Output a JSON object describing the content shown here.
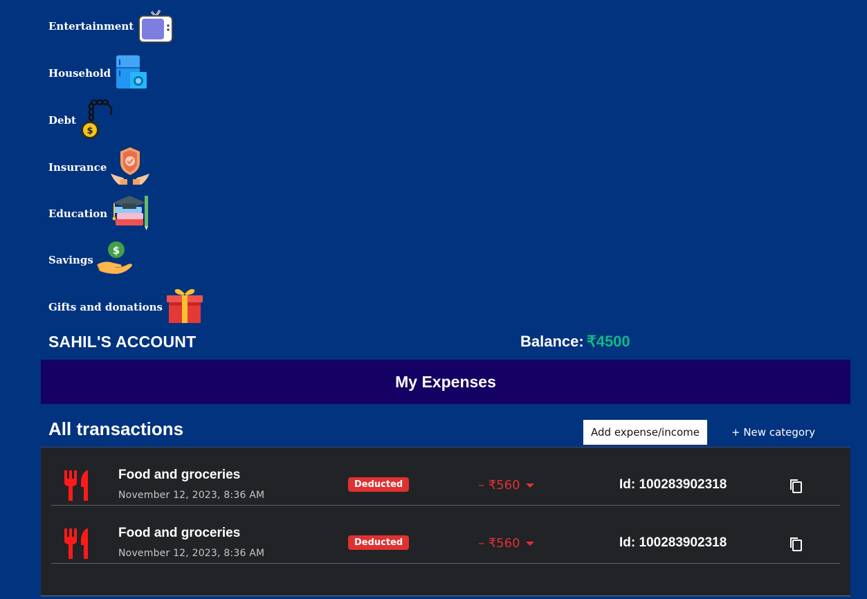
{
  "categories": [
    {
      "label": "Entertainment",
      "icon": "tv-icon"
    },
    {
      "label": "Household",
      "icon": "appliances-icon"
    },
    {
      "label": "Debt",
      "icon": "ball-and-chain-icon"
    },
    {
      "label": "Insurance",
      "icon": "shield-hands-icon"
    },
    {
      "label": "Education",
      "icon": "graduation-books-icon"
    },
    {
      "label": "Savings",
      "icon": "money-hand-icon"
    },
    {
      "label": "Gifts and donations",
      "icon": "gift-box-icon"
    }
  ],
  "account": {
    "name": "SAHIL'S ACCOUNT",
    "balance_label": "Balance:",
    "balance_value": "₹4500"
  },
  "expenses": {
    "title": "My Expenses",
    "all_transactions_label": "All transactions",
    "add_button_label": "Add expense/income",
    "new_category_label": "+ New category"
  },
  "transactions": [
    {
      "title": "Food and groceries",
      "date": "November 12, 2023, 8:36 AM",
      "status": "Deducted",
      "amount": "– ₹560",
      "id_text": "Id: 100283902318",
      "icon": "fork-knife-icon"
    },
    {
      "title": "Food and groceries",
      "date": "November 12, 2023, 8:36 AM",
      "status": "Deducted",
      "amount": "– ₹560",
      "id_text": "Id: 100283902318",
      "icon": "fork-knife-icon"
    }
  ],
  "colors": {
    "page_bg": "#01337f",
    "header_bg": "#150063",
    "panel_bg": "#212327",
    "balance_green": "#12b886",
    "deducted_red": "#e03131"
  }
}
